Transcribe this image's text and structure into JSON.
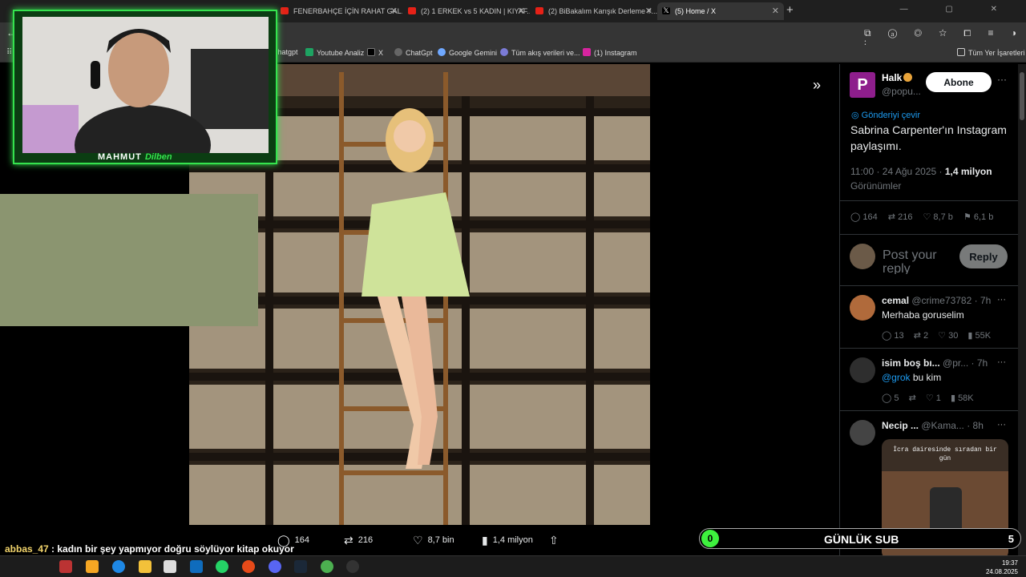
{
  "browser": {
    "tabs": [
      {
        "title": "FENERBAHÇE İÇİN RAHAT GAL..."
      },
      {
        "title": "(2) 1 ERKEK vs 5 KADIN | KIYAF..."
      },
      {
        "title": "(2) BiBakalım Karışık Derleme #..."
      },
      {
        "title": "(5) Home / X"
      }
    ],
    "new_tab": "+",
    "bookmarks": [
      "Chatgpt",
      "Youtube Analiz",
      "X",
      "ChatGpt",
      "Google Gemini",
      "Tüm akış verileri ve...",
      "(1) Instagram"
    ],
    "all_bookmarks": "Tüm Yer İşaretleri"
  },
  "overlay": {
    "streamer_first": "MAHMUT",
    "streamer_second": "Dilben",
    "chat": [
      {
        "user": "abbas_47",
        "message": "kadın bir şey yapmıyor doğru söylüyor kitap okuyor"
      },
      {
        "user": "abbas_47",
        "message": ""
      }
    ],
    "sub_count": "0",
    "sub_label": "GÜNLÜK SUB",
    "sub_goal": "5"
  },
  "media_actions": {
    "replies": "164",
    "reposts": "216",
    "likes": "8,7 bin",
    "views": "1,4 milyon"
  },
  "tweet": {
    "logo_letter": "P",
    "author": "Halk",
    "handle": "@popu...",
    "follow_label": "Abone",
    "more": "···",
    "translate": "Gönderiyi çevir",
    "text": "Sabrina Carpenter'ın Instagram paylaşımı.",
    "time": "11:00 · 24 Ağu 2025 · ",
    "views": "1,4 milyon",
    "views_label": "Görünümler",
    "stats": {
      "replies": "164",
      "reposts": "216",
      "likes": "8,7 b",
      "bookmarks": "6,1 b"
    },
    "reply_placeholder": "Post your reply",
    "reply_button": "Reply"
  },
  "comments": [
    {
      "name": "cemal",
      "handle": "@crime73782 · 7h",
      "text": "Merhaba goruselim",
      "mention": "",
      "replies": "13",
      "reposts": "2",
      "likes": "30",
      "views": "55K"
    },
    {
      "name": "isim boş bı...",
      "handle": "@pr... · 7h",
      "text": "bu kim",
      "mention": "@grok",
      "replies": "5",
      "reposts": "",
      "likes": "1",
      "views": "58K"
    },
    {
      "name": "Necip ...",
      "handle": "@Kama... · 8h",
      "image_caption": "İcra dairesinde sıradan bir gün"
    }
  ],
  "clock": {
    "time": "19:37",
    "date": "24.08.2025"
  },
  "colors": {
    "accent": "#1d9bf0",
    "stream_green": "#35e34e",
    "follow_bg": "#ffffff",
    "panel_bg": "#000000"
  }
}
